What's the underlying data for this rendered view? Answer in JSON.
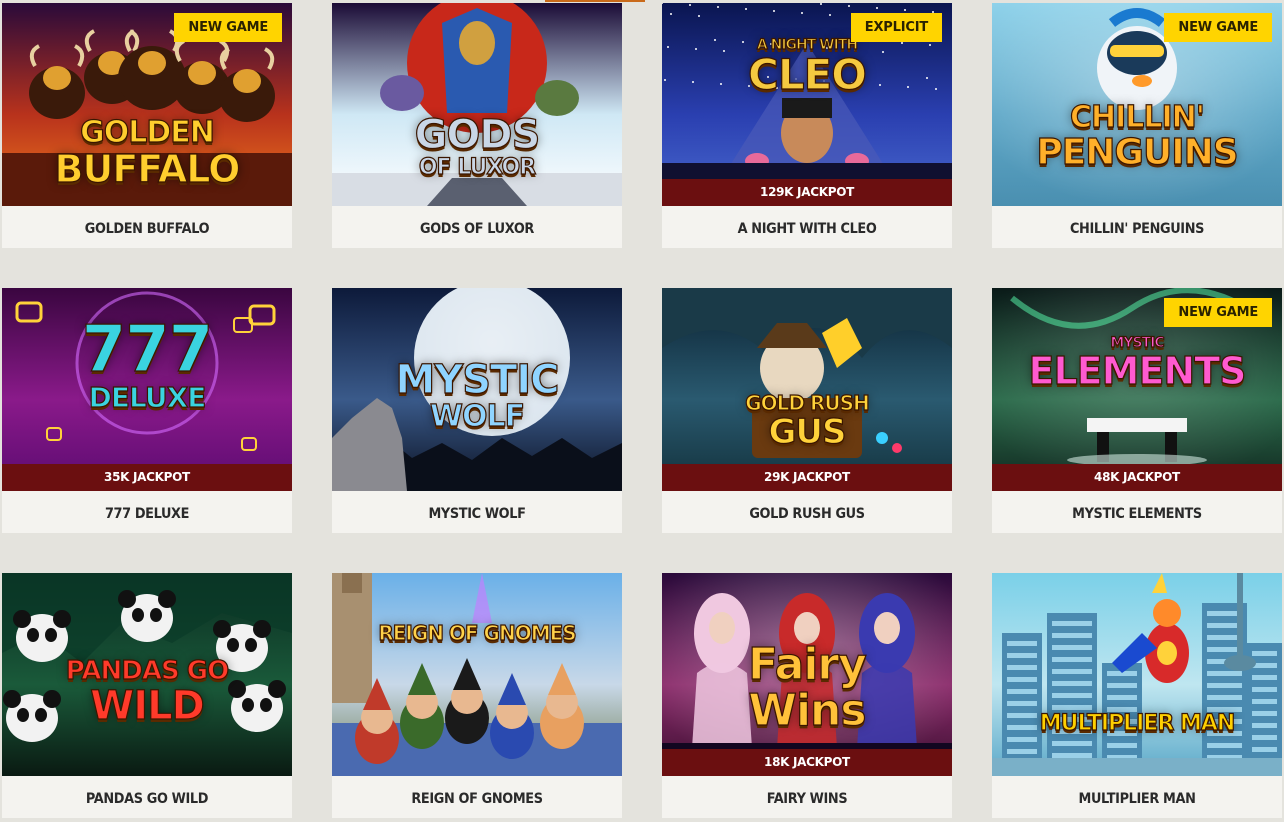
{
  "games": [
    {
      "name": "GOLDEN BUFFALO",
      "art_title": "GOLDEN BUFFALO",
      "badge": "NEW GAME",
      "jackpot": "",
      "art": "buffalo"
    },
    {
      "name": "GODS OF LUXOR",
      "art_title": "GODS OF LUXOR",
      "badge": "",
      "jackpot": "",
      "art": "luxor"
    },
    {
      "name": "A NIGHT WITH CLEO",
      "art_title": "A NIGHT WITH CLEO",
      "badge": "EXPLICIT",
      "jackpot": "129K JACKPOT",
      "art": "cleo"
    },
    {
      "name": "CHILLIN' PENGUINS",
      "art_title": "CHILLIN' PENGUINS",
      "badge": "NEW GAME",
      "jackpot": "",
      "art": "penguins"
    },
    {
      "name": "777 DELUXE",
      "art_title": "777 DELUXE",
      "badge": "",
      "jackpot": "35K JACKPOT",
      "art": "777"
    },
    {
      "name": "MYSTIC WOLF",
      "art_title": "MYSTIC WOLF",
      "badge": "",
      "jackpot": "",
      "art": "wolf"
    },
    {
      "name": "GOLD RUSH GUS",
      "art_title": "GOLD RUSH GUS",
      "badge": "",
      "jackpot": "29K JACKPOT",
      "art": "gus"
    },
    {
      "name": "MYSTIC ELEMENTS",
      "art_title": "MYSTIC ELEMENTS",
      "badge": "NEW GAME",
      "jackpot": "48K JACKPOT",
      "art": "elements"
    },
    {
      "name": "PANDAS GO WILD",
      "art_title": "PANDAS GO WILD",
      "badge": "",
      "jackpot": "",
      "art": "pandas"
    },
    {
      "name": "REIGN OF GNOMES",
      "art_title": "REIGN OF GNOMES",
      "badge": "",
      "jackpot": "",
      "art": "gnomes"
    },
    {
      "name": "FAIRY WINS",
      "art_title": "Fairy Wins",
      "badge": "",
      "jackpot": "18K JACKPOT",
      "art": "fairy"
    },
    {
      "name": "MULTIPLIER MAN",
      "art_title": "MULTIPLIER MAN",
      "badge": "",
      "jackpot": "",
      "art": "multiplier"
    }
  ],
  "colors": {
    "page_bg": "#e4e3dd",
    "card_bg": "#f4f3ef",
    "badge_bg": "#ffd400",
    "jackpot_bg": "#6b0f10"
  }
}
